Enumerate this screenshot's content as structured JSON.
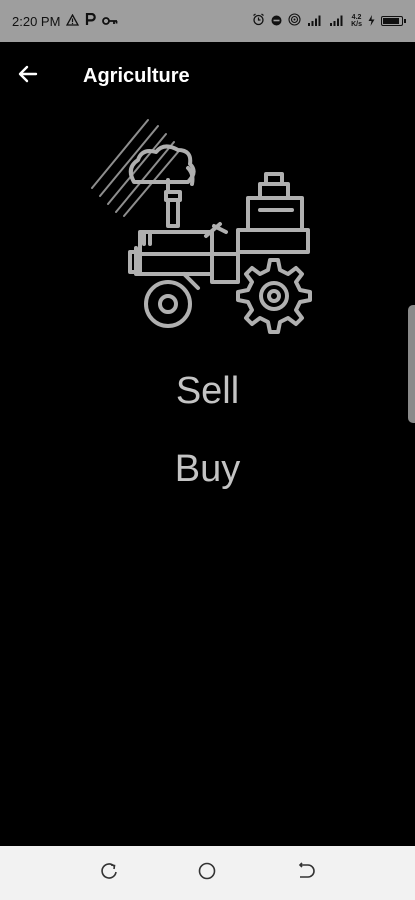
{
  "status_bar": {
    "time": "2:20 PM",
    "speed_value": "4.2",
    "speed_unit": "K/s",
    "battery_level": 0.9,
    "icons": [
      "warning-icon",
      "parking-icon",
      "key-icon",
      "alarm-icon",
      "dnd-icon",
      "hotspot-icon",
      "signal-icon",
      "signal-icon",
      "battery-icon"
    ]
  },
  "app_bar": {
    "title": "Agriculture",
    "back_icon": "arrow-left-icon"
  },
  "hero": {
    "icon": "tractor-icon"
  },
  "actions": {
    "sell_label": "Sell",
    "buy_label": "Buy"
  },
  "nav_bar": {
    "icons": [
      "recents-icon",
      "home-icon",
      "back-icon"
    ]
  },
  "colors": {
    "status_bar_bg": "#9e9e9e",
    "app_bg": "#000000",
    "action_text": "#c4c4c4",
    "icon_stroke": "#b0b0b0",
    "nav_bar_bg": "#f2f2f2"
  }
}
